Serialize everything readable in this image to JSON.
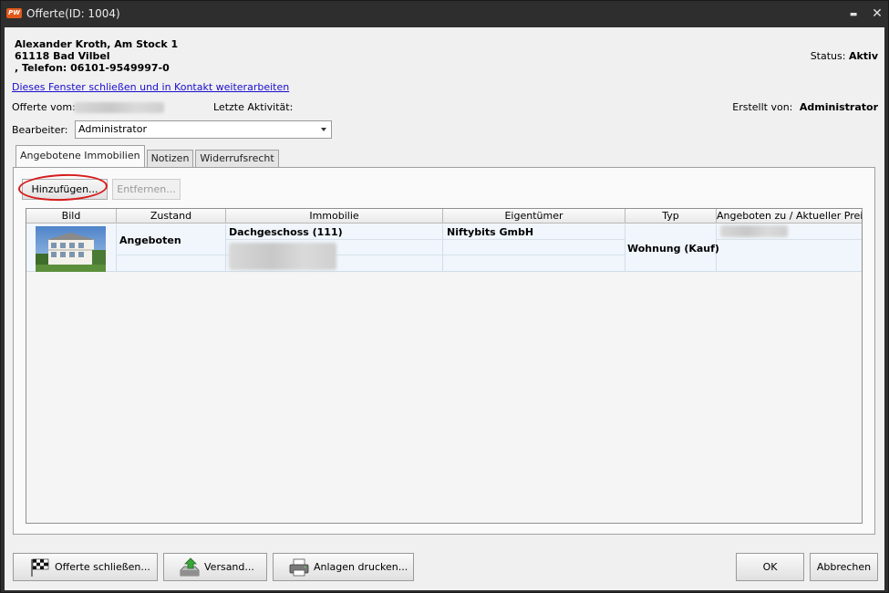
{
  "window": {
    "logo_text": "PW",
    "title": "Offerte(ID: 1004)",
    "minimize_glyph": "▬",
    "close_glyph": "✕"
  },
  "contact": {
    "line1": "Alexander Kroth, Am Stock 1",
    "line2": "61118 Bad Vilbel",
    "line3": ", Telefon: 06101-9549997-0"
  },
  "status": {
    "label": "Status:",
    "value": "Aktiv"
  },
  "close_link": "Dieses Fenster schließen und in Kontakt weiterarbeiten",
  "meta": {
    "offer_date_label": "Offerte vom:",
    "last_activity_label": "Letzte Aktivität:",
    "created_by_label": "Erstellt von:",
    "created_by_value": "Administrator"
  },
  "editor": {
    "label": "Bearbeiter:",
    "value": "Administrator"
  },
  "tabs": [
    {
      "label": "Angebotene Immobilien",
      "active": true
    },
    {
      "label": "Notizen",
      "active": false
    },
    {
      "label": "Widerrufsrecht",
      "active": false
    }
  ],
  "toolbar": {
    "add_label": "Hinzufügen...",
    "remove_label": "Entfernen..."
  },
  "table": {
    "columns": [
      "Bild",
      "Zustand",
      "Immobilie",
      "Eigentümer",
      "Typ",
      "Angeboten zu / Aktueller Preis"
    ],
    "rows": [
      {
        "status": "Angeboten",
        "property": "Dachgeschoss (111)",
        "owner": "Niftybits GmbH",
        "type": "Wohnung (Kauf)"
      }
    ]
  },
  "footer": {
    "close_offer": "Offerte schließen...",
    "send": "Versand...",
    "print_attachments": "Anlagen drucken...",
    "ok": "OK",
    "cancel": "Abbrechen"
  },
  "icons": {
    "close_offer": "checkered-flag-icon",
    "send": "outbox-arrow-icon",
    "print": "printer-icon"
  },
  "colors": {
    "titlebar": "#2e2e2e",
    "link": "#1a0dcc",
    "highlight": "#d61c1c",
    "row_background": "#f0f6fc"
  }
}
